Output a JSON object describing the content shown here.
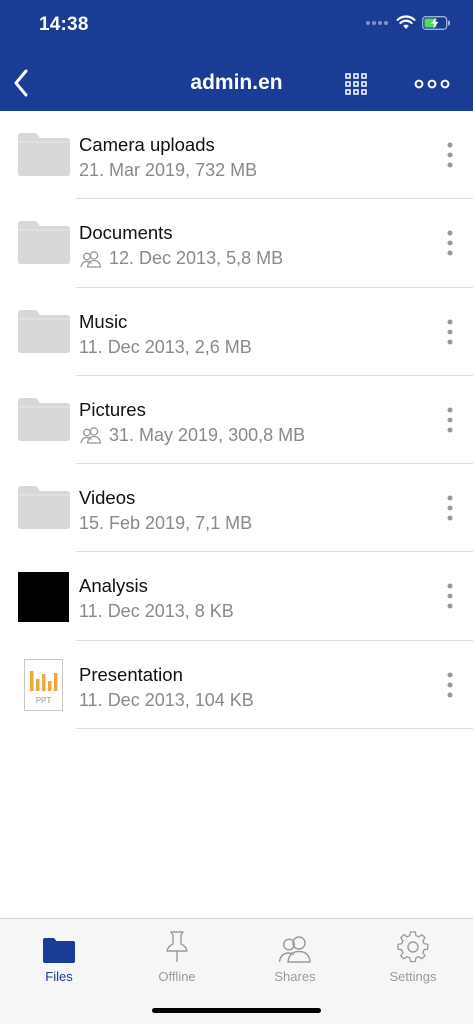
{
  "status_bar": {
    "time": "14:38"
  },
  "header": {
    "title": "admin.en"
  },
  "colors": {
    "brand": "#1b3c94",
    "folder": "#d8d8d8",
    "meta_text": "#8a8a8a",
    "divider": "#dcdcdc",
    "ppt_accent": "#f0a640"
  },
  "files": [
    {
      "name": "Camera uploads",
      "meta": "21. Mar 2019, 732 MB",
      "type": "folder",
      "shared": false
    },
    {
      "name": "Documents",
      "meta": "12. Dec 2013, 5,8 MB",
      "type": "folder",
      "shared": true
    },
    {
      "name": "Music",
      "meta": "11. Dec 2013, 2,6 MB",
      "type": "folder",
      "shared": false
    },
    {
      "name": "Pictures",
      "meta": "31. May 2019, 300,8 MB",
      "type": "folder",
      "shared": true
    },
    {
      "name": "Videos",
      "meta": "15. Feb 2019, 7,1 MB",
      "type": "folder",
      "shared": false
    },
    {
      "name": "Analysis",
      "meta": "11. Dec 2013, 8 KB",
      "type": "image",
      "shared": false
    },
    {
      "name": "Presentation",
      "meta": "11. Dec 2013, 104 KB",
      "type": "ppt",
      "ppt_label": "PPT",
      "shared": false
    }
  ],
  "tabs": [
    {
      "label": "Files",
      "icon": "folder-icon",
      "active": true
    },
    {
      "label": "Offline",
      "icon": "pin-icon",
      "active": false
    },
    {
      "label": "Shares",
      "icon": "users-icon",
      "active": false
    },
    {
      "label": "Settings",
      "icon": "gear-icon",
      "active": false
    }
  ]
}
